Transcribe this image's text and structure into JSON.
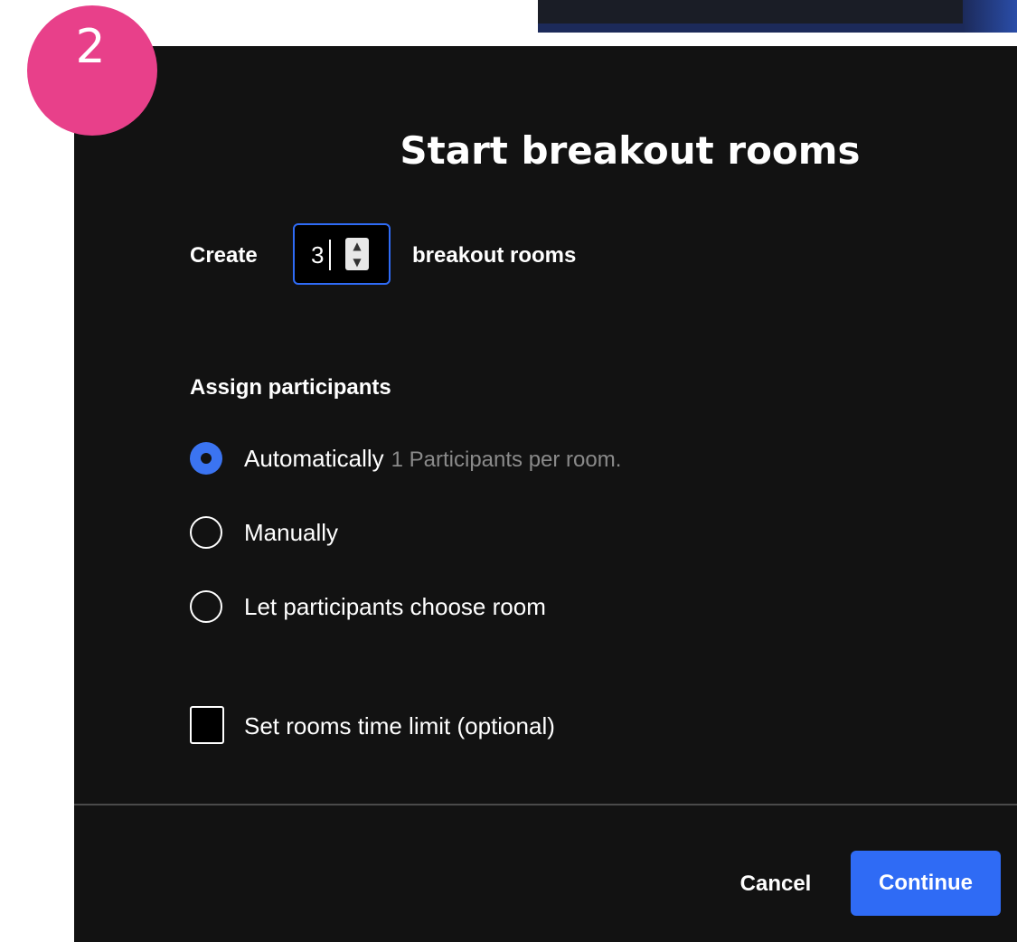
{
  "step_badge": {
    "number": "2",
    "color": "#e8408a"
  },
  "dialog": {
    "title": "Start breakout rooms",
    "create_row": {
      "prefix": "Create",
      "room_count": "3",
      "suffix": "breakout rooms"
    },
    "assign": {
      "heading": "Assign participants",
      "options": [
        {
          "label": "Automatically",
          "detail": "1 Participants per room.",
          "selected": true
        },
        {
          "label": "Manually",
          "detail": "",
          "selected": false
        },
        {
          "label": "Let participants choose room",
          "detail": "",
          "selected": false
        }
      ]
    },
    "time_limit": {
      "label": "Set rooms time limit (optional)",
      "checked": false
    },
    "footer": {
      "cancel_label": "Cancel",
      "continue_label": "Continue"
    }
  },
  "icons": {
    "spinner": "up-down-spinner-icon",
    "radio": "radio-button",
    "checkbox": "checkbox"
  },
  "colors": {
    "accent": "#2f6bf5",
    "dialog_background": "#121212",
    "muted_text": "#8a8a8a"
  }
}
